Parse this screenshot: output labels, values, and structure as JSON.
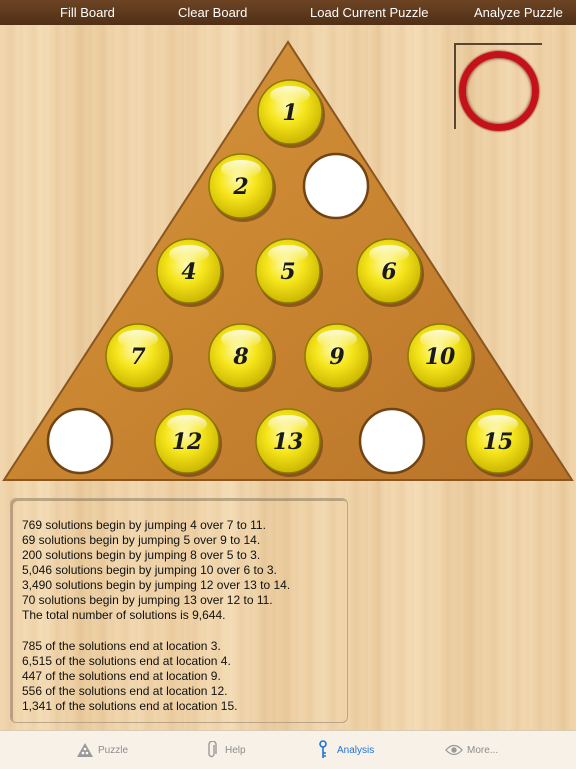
{
  "toolbar": {
    "fill_board": "Fill Board",
    "clear_board": "Clear Board",
    "load_current_puzzle": "Load Current Puzzle",
    "analyze_puzzle": "Analyze Puzzle"
  },
  "board": {
    "pegs": [
      {
        "label": "1",
        "filled": true
      },
      {
        "label": "2",
        "filled": true
      },
      {
        "label": "",
        "filled": false
      },
      {
        "label": "4",
        "filled": true
      },
      {
        "label": "5",
        "filled": true
      },
      {
        "label": "6",
        "filled": true
      },
      {
        "label": "7",
        "filled": true
      },
      {
        "label": "8",
        "filled": true
      },
      {
        "label": "9",
        "filled": true
      },
      {
        "label": "10",
        "filled": true
      },
      {
        "label": "",
        "filled": false
      },
      {
        "label": "12",
        "filled": true
      },
      {
        "label": "13",
        "filled": true
      },
      {
        "label": "",
        "filled": false
      },
      {
        "label": "15",
        "filled": true
      }
    ],
    "peg_color": "#f6e61c",
    "ring_color": "#c4121b"
  },
  "analysis": {
    "jump_lines": [
      "769 solutions begin by jumping 4 over 7 to 11.",
      "69 solutions begin by jumping 5 over 9 to 14.",
      "200 solutions begin by jumping 8 over 5 to 3.",
      "5,046 solutions begin by jumping 10 over 6 to 3.",
      "3,490 solutions begin by jumping 12 over 13 to 14.",
      "70 solutions begin by jumping 13 over 12 to 11.",
      "The total number of solutions is 9,644."
    ],
    "end_lines": [
      "785 of the solutions end at location 3.",
      "6,515 of the solutions end at location 4.",
      "447 of the solutions end at location 9.",
      "556 of the solutions end at location 12.",
      "1,341 of the solutions end at location 15."
    ]
  },
  "tabs": [
    {
      "label": "Puzzle",
      "icon": "triangle-icon",
      "active": false
    },
    {
      "label": "Help",
      "icon": "paperclip-icon",
      "active": false
    },
    {
      "label": "Analysis",
      "icon": "key-icon",
      "active": true
    },
    {
      "label": "More...",
      "icon": "eye-icon",
      "active": false
    }
  ],
  "accent_color": "#1e74d9"
}
